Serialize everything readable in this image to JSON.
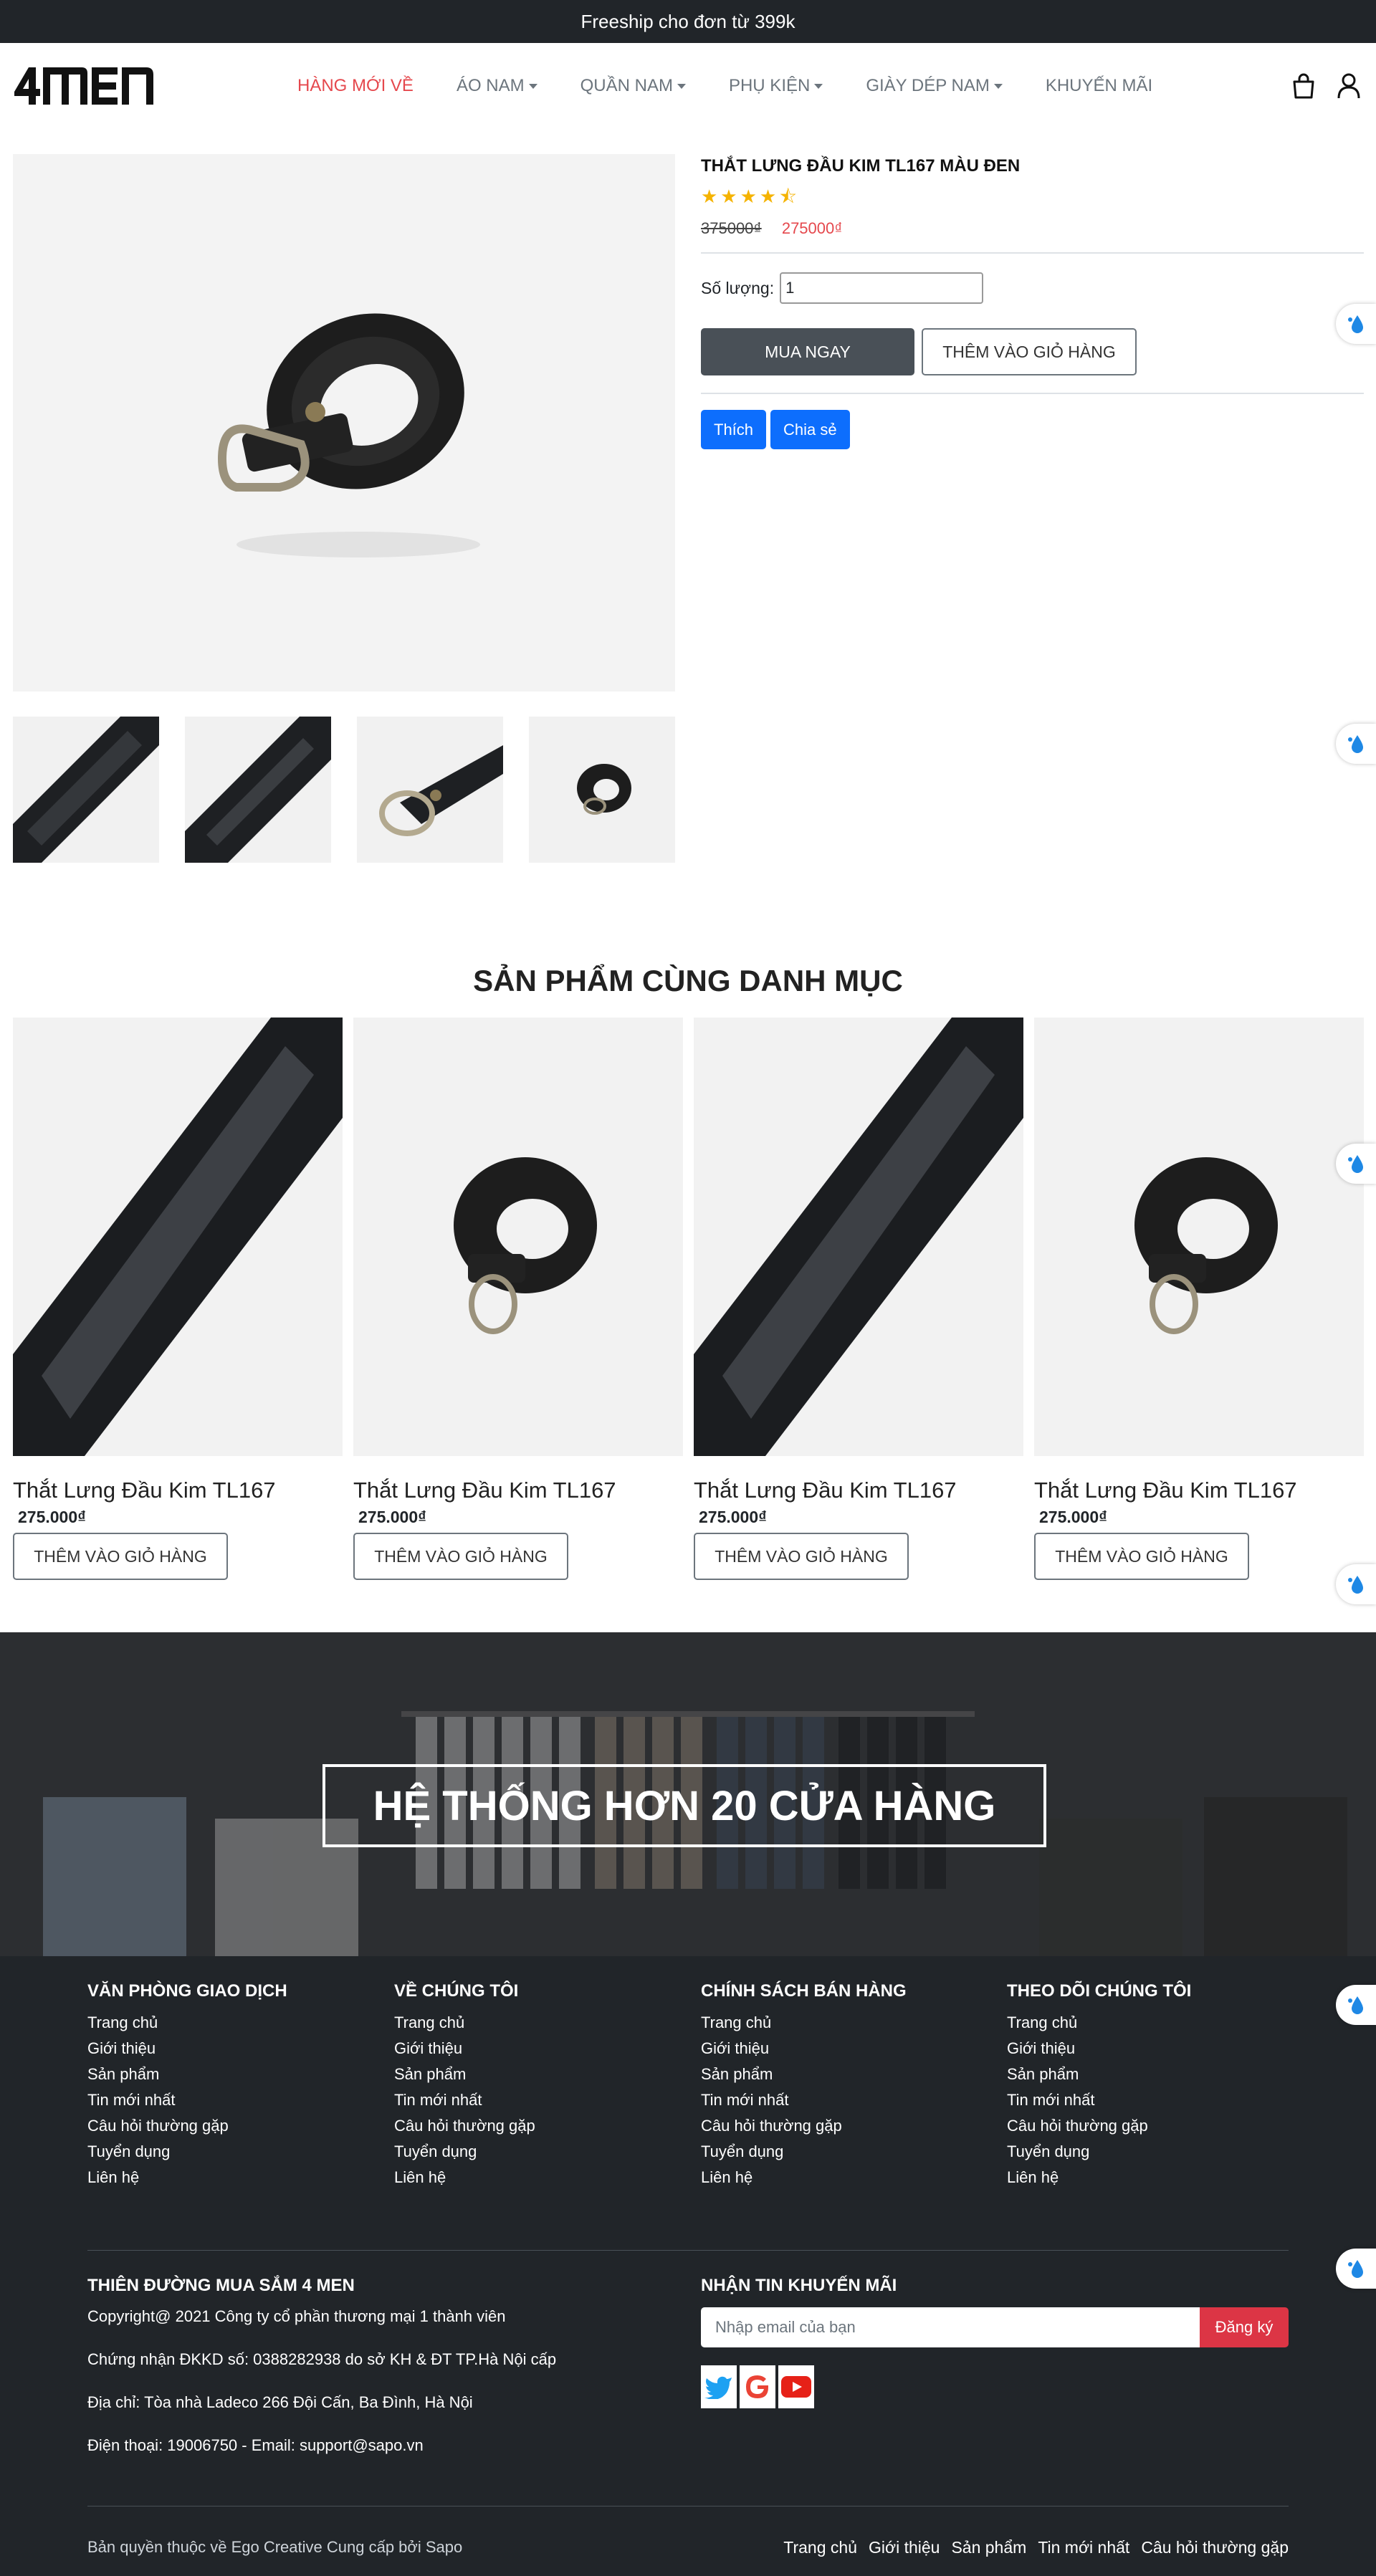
{
  "topbar": {
    "text": "Freeship cho đơn từ 399k"
  },
  "header": {
    "logo_text": "4MEN",
    "nav": [
      {
        "label": "HÀNG MỚI VỀ",
        "active": true,
        "dropdown": false
      },
      {
        "label": "ÁO NAM",
        "active": false,
        "dropdown": true
      },
      {
        "label": "QUẦN NAM",
        "active": false,
        "dropdown": true
      },
      {
        "label": "PHỤ KIỆN",
        "active": false,
        "dropdown": true
      },
      {
        "label": "GIÀY DÉP NAM",
        "active": false,
        "dropdown": true
      },
      {
        "label": "KHUYẾN MÃI",
        "active": false,
        "dropdown": false
      }
    ],
    "icons": [
      "shopping-bag-icon",
      "user-icon"
    ]
  },
  "product": {
    "title": "THẮT LƯNG ĐẦU KIM TL167 MÀU ĐEN",
    "rating": 4.5,
    "stars_text": "★★★★⯪",
    "old_price": "375000₫",
    "new_price": "275000₫",
    "qty_label": "Số lượng:",
    "qty_value": "1",
    "buy_label": "MUA NGAY",
    "cart_label": "THÊM VÀO GIỎ HÀNG",
    "like_label": "Thích",
    "share_label": "Chia sẻ"
  },
  "related": {
    "title": "SẢN PHẨM CÙNG DANH MỤC",
    "items": [
      {
        "name": "Thắt Lưng Đầu Kim TL167",
        "price": "275.000₫",
        "button": "THÊM VÀO GIỎ HÀNG",
        "image": "closeup"
      },
      {
        "name": "Thắt Lưng Đầu Kim TL167",
        "price": "275.000₫",
        "button": "THÊM VÀO GIỎ HÀNG",
        "image": "coil"
      },
      {
        "name": "Thắt Lưng Đầu Kim TL167",
        "price": "275.000₫",
        "button": "THÊM VÀO GIỎ HÀNG",
        "image": "closeup"
      },
      {
        "name": "Thắt Lưng Đầu Kim TL167",
        "price": "275.000₫",
        "button": "THÊM VÀO GIỎ HÀNG",
        "image": "coil"
      }
    ]
  },
  "banner": {
    "text": "HỆ THỐNG HƠN 20 CỬA HÀNG"
  },
  "footer": {
    "columns": [
      {
        "title": "VĂN PHÒNG GIAO DỊCH",
        "links": [
          "Trang chủ",
          "Giới thiệu",
          "Sản phẩm",
          "Tin mới nhất",
          "Câu hỏi thường gặp",
          "Tuyển dụng",
          "Liên hệ"
        ]
      },
      {
        "title": "VỀ CHÚNG TÔI",
        "links": [
          "Trang chủ",
          "Giới thiệu",
          "Sản phẩm",
          "Tin mới nhất",
          "Câu hỏi thường gặp",
          "Tuyển dụng",
          "Liên hệ"
        ]
      },
      {
        "title": "CHÍNH SÁCH BÁN HÀNG",
        "links": [
          "Trang chủ",
          "Giới thiệu",
          "Sản phẩm",
          "Tin mới nhất",
          "Câu hỏi thường gặp",
          "Tuyển dụng",
          "Liên hệ"
        ]
      },
      {
        "title": "THEO DÕI CHÚNG TÔI",
        "links": [
          "Trang chủ",
          "Giới thiệu",
          "Sản phẩm",
          "Tin mới nhất",
          "Câu hỏi thường gặp",
          "Tuyển dụng",
          "Liên hệ"
        ]
      }
    ],
    "company": {
      "title": "THIÊN ĐƯỜNG MUA SẮM 4 MEN",
      "lines": [
        "Copyright@ 2021 Công ty cổ phần thương mại 1 thành viên",
        "Chứng nhận ĐKKD số: 0388282938 do sở KH & ĐT TP.Hà Nội cấp",
        "Địa chỉ: Tòa nhà Ladeco 266 Đội Cấn, Ba Đình, Hà Nội",
        "Điện thoại: 19006750 - Email: support@sapo.vn"
      ]
    },
    "newsletter": {
      "title": "NHẬN TIN KHUYẾN MÃI",
      "placeholder": "Nhập email của bạn",
      "button": "Đăng ký",
      "social_icons": [
        "twitter-icon",
        "google-icon",
        "youtube-icon"
      ]
    },
    "copyright": "Bản quyền thuộc về Ego Creative Cung cấp bởi Sapo",
    "bottom_links": [
      "Trang chủ",
      "Giới thiệu",
      "Sản phẩm",
      "Tin mới nhất",
      "Câu hỏi thường gặp"
    ]
  },
  "colors": {
    "accent_red": "#e5484d",
    "dark": "#212529",
    "primary_blue": "#0d6efd",
    "star": "#f5b301"
  }
}
